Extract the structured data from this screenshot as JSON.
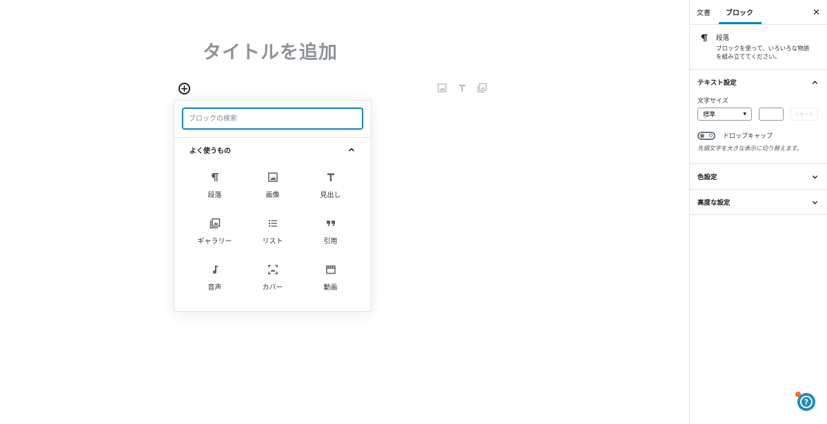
{
  "editor": {
    "title_placeholder": "タイトルを追加",
    "inserter_toggle": "+",
    "quick_inserter_icons": [
      "image-icon",
      "heading-icon",
      "gallery-icon"
    ]
  },
  "inserter": {
    "search_placeholder": "ブロックの検索",
    "panel_title": "よく使うもの",
    "blocks": [
      {
        "label": "段落",
        "icon": "paragraph-icon"
      },
      {
        "label": "画像",
        "icon": "image-icon"
      },
      {
        "label": "見出し",
        "icon": "heading-icon"
      },
      {
        "label": "ギャラリー",
        "icon": "gallery-icon"
      },
      {
        "label": "リスト",
        "icon": "list-icon"
      },
      {
        "label": "引用",
        "icon": "quote-icon"
      },
      {
        "label": "音声",
        "icon": "audio-icon"
      },
      {
        "label": "カバー",
        "icon": "cover-icon"
      },
      {
        "label": "動画",
        "icon": "video-icon"
      }
    ]
  },
  "sidebar": {
    "tabs": [
      "文書",
      "ブロック"
    ],
    "active_tab": "ブロック",
    "close_icon": "close-icon",
    "block_card": {
      "icon": "paragraph-icon",
      "title": "段落",
      "description_line1": "ブロックを使って、いろいろな物語",
      "description_line2": "を組み立ててください。"
    },
    "text_settings": {
      "title": "テキスト設定",
      "font_size_label": "文字サイズ",
      "font_size_value": "標準",
      "custom_size_value": "",
      "reset_label": "リセット",
      "drop_cap_label": "ドロップキャップ",
      "drop_cap_enabled": false,
      "drop_cap_help": "先頭文字を大きな表示に切り替えます。"
    },
    "color_settings": {
      "title": "色設定"
    },
    "advanced_settings": {
      "title": "高度な設定"
    }
  },
  "help_button": {
    "icon": "help-icon",
    "label": "?"
  },
  "colors": {
    "accent": "#0085ba",
    "input_focus": "#1e8cbe",
    "notification": "#f86f1e"
  }
}
